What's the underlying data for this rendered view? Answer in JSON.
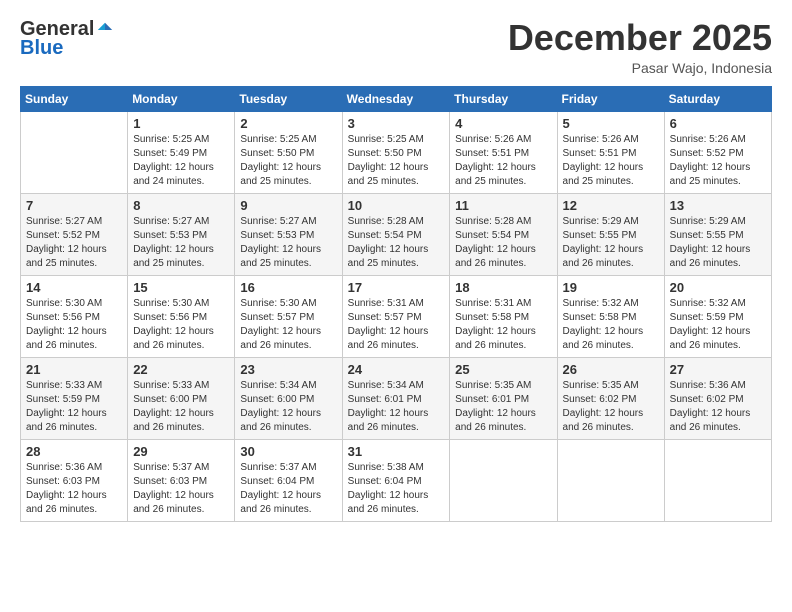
{
  "logo": {
    "general": "General",
    "blue": "Blue"
  },
  "header": {
    "month": "December 2025",
    "location": "Pasar Wajo, Indonesia"
  },
  "weekdays": [
    "Sunday",
    "Monday",
    "Tuesday",
    "Wednesday",
    "Thursday",
    "Friday",
    "Saturday"
  ],
  "weeks": [
    [
      {
        "day": "",
        "sunrise": "",
        "sunset": "",
        "daylight": ""
      },
      {
        "day": "1",
        "sunrise": "5:25 AM",
        "sunset": "5:49 PM",
        "daylight": "12 hours and 24 minutes."
      },
      {
        "day": "2",
        "sunrise": "5:25 AM",
        "sunset": "5:50 PM",
        "daylight": "12 hours and 25 minutes."
      },
      {
        "day": "3",
        "sunrise": "5:25 AM",
        "sunset": "5:50 PM",
        "daylight": "12 hours and 25 minutes."
      },
      {
        "day": "4",
        "sunrise": "5:26 AM",
        "sunset": "5:51 PM",
        "daylight": "12 hours and 25 minutes."
      },
      {
        "day": "5",
        "sunrise": "5:26 AM",
        "sunset": "5:51 PM",
        "daylight": "12 hours and 25 minutes."
      },
      {
        "day": "6",
        "sunrise": "5:26 AM",
        "sunset": "5:52 PM",
        "daylight": "12 hours and 25 minutes."
      }
    ],
    [
      {
        "day": "7",
        "sunrise": "5:27 AM",
        "sunset": "5:52 PM",
        "daylight": "12 hours and 25 minutes."
      },
      {
        "day": "8",
        "sunrise": "5:27 AM",
        "sunset": "5:53 PM",
        "daylight": "12 hours and 25 minutes."
      },
      {
        "day": "9",
        "sunrise": "5:27 AM",
        "sunset": "5:53 PM",
        "daylight": "12 hours and 25 minutes."
      },
      {
        "day": "10",
        "sunrise": "5:28 AM",
        "sunset": "5:54 PM",
        "daylight": "12 hours and 25 minutes."
      },
      {
        "day": "11",
        "sunrise": "5:28 AM",
        "sunset": "5:54 PM",
        "daylight": "12 hours and 26 minutes."
      },
      {
        "day": "12",
        "sunrise": "5:29 AM",
        "sunset": "5:55 PM",
        "daylight": "12 hours and 26 minutes."
      },
      {
        "day": "13",
        "sunrise": "5:29 AM",
        "sunset": "5:55 PM",
        "daylight": "12 hours and 26 minutes."
      }
    ],
    [
      {
        "day": "14",
        "sunrise": "5:30 AM",
        "sunset": "5:56 PM",
        "daylight": "12 hours and 26 minutes."
      },
      {
        "day": "15",
        "sunrise": "5:30 AM",
        "sunset": "5:56 PM",
        "daylight": "12 hours and 26 minutes."
      },
      {
        "day": "16",
        "sunrise": "5:30 AM",
        "sunset": "5:57 PM",
        "daylight": "12 hours and 26 minutes."
      },
      {
        "day": "17",
        "sunrise": "5:31 AM",
        "sunset": "5:57 PM",
        "daylight": "12 hours and 26 minutes."
      },
      {
        "day": "18",
        "sunrise": "5:31 AM",
        "sunset": "5:58 PM",
        "daylight": "12 hours and 26 minutes."
      },
      {
        "day": "19",
        "sunrise": "5:32 AM",
        "sunset": "5:58 PM",
        "daylight": "12 hours and 26 minutes."
      },
      {
        "day": "20",
        "sunrise": "5:32 AM",
        "sunset": "5:59 PM",
        "daylight": "12 hours and 26 minutes."
      }
    ],
    [
      {
        "day": "21",
        "sunrise": "5:33 AM",
        "sunset": "5:59 PM",
        "daylight": "12 hours and 26 minutes."
      },
      {
        "day": "22",
        "sunrise": "5:33 AM",
        "sunset": "6:00 PM",
        "daylight": "12 hours and 26 minutes."
      },
      {
        "day": "23",
        "sunrise": "5:34 AM",
        "sunset": "6:00 PM",
        "daylight": "12 hours and 26 minutes."
      },
      {
        "day": "24",
        "sunrise": "5:34 AM",
        "sunset": "6:01 PM",
        "daylight": "12 hours and 26 minutes."
      },
      {
        "day": "25",
        "sunrise": "5:35 AM",
        "sunset": "6:01 PM",
        "daylight": "12 hours and 26 minutes."
      },
      {
        "day": "26",
        "sunrise": "5:35 AM",
        "sunset": "6:02 PM",
        "daylight": "12 hours and 26 minutes."
      },
      {
        "day": "27",
        "sunrise": "5:36 AM",
        "sunset": "6:02 PM",
        "daylight": "12 hours and 26 minutes."
      }
    ],
    [
      {
        "day": "28",
        "sunrise": "5:36 AM",
        "sunset": "6:03 PM",
        "daylight": "12 hours and 26 minutes."
      },
      {
        "day": "29",
        "sunrise": "5:37 AM",
        "sunset": "6:03 PM",
        "daylight": "12 hours and 26 minutes."
      },
      {
        "day": "30",
        "sunrise": "5:37 AM",
        "sunset": "6:04 PM",
        "daylight": "12 hours and 26 minutes."
      },
      {
        "day": "31",
        "sunrise": "5:38 AM",
        "sunset": "6:04 PM",
        "daylight": "12 hours and 26 minutes."
      },
      {
        "day": "",
        "sunrise": "",
        "sunset": "",
        "daylight": ""
      },
      {
        "day": "",
        "sunrise": "",
        "sunset": "",
        "daylight": ""
      },
      {
        "day": "",
        "sunrise": "",
        "sunset": "",
        "daylight": ""
      }
    ]
  ],
  "labels": {
    "sunrise_prefix": "Sunrise: ",
    "sunset_prefix": "Sunset: ",
    "daylight_prefix": "Daylight: "
  }
}
